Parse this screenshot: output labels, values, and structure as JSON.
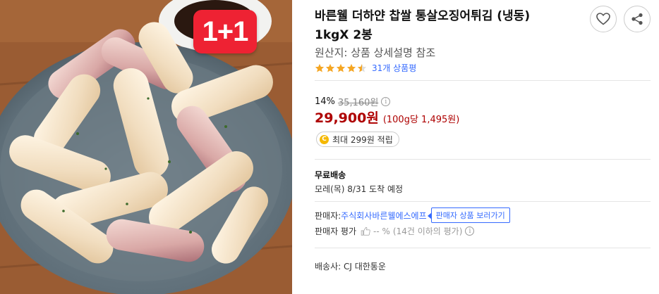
{
  "product": {
    "promo_badge": "1+1",
    "title": "바른웰 더하얀 찹쌀 통살오징어튀김 (냉동) 1kgX 2봉",
    "origin": "원산지: 상품 상세설명 참조",
    "rating": 4.5,
    "review_count": "31개 상품평"
  },
  "price": {
    "discount_rate": "14%",
    "original_price": "35,160원",
    "sale_price": "29,900원",
    "unit_price": "(100g당 1,495원)",
    "reward": "최대 299원 적립",
    "reward_icon_label": "C"
  },
  "shipping": {
    "title": "무료배송",
    "arrival": "모레(목) 8/31 도착 예정"
  },
  "seller": {
    "label": "판매자: ",
    "name": "주식회사바른웰에스에프",
    "tooltip": "판매자 상품 보러가기",
    "rating_label": "판매자 평가",
    "rating_value": "-- %",
    "rating_note": "(14건 이하의 평가)"
  },
  "delivery": {
    "carrier": "배송사: CJ 대한통운"
  },
  "icons": {
    "wish": "heart-icon",
    "share": "share-icon",
    "info": "i"
  },
  "colors": {
    "price": "#ae0000",
    "link": "#346aff",
    "star": "#f5a623",
    "badge": "#ee2233"
  }
}
